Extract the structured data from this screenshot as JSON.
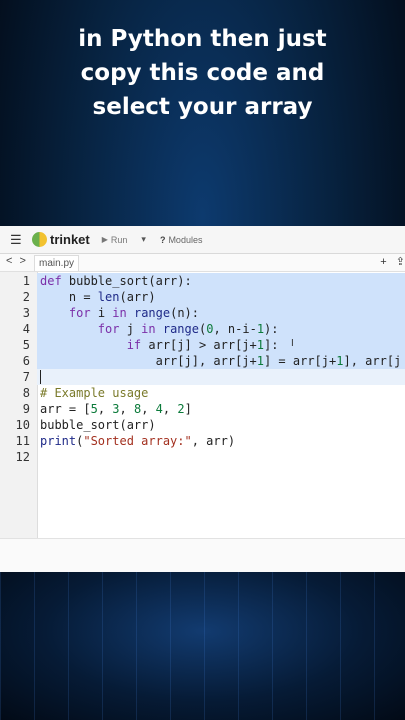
{
  "caption": {
    "line1": "in Python then just",
    "line2": "copy this code and",
    "line3": "select your array"
  },
  "toolbar": {
    "brand": "trinket",
    "run_label": "Run",
    "dropdown_glyph": "▾",
    "modules_label": "Modules",
    "modules_glyph": "?"
  },
  "tabs": {
    "nav": "< >",
    "file_name": "main.py",
    "add_glyph": "+",
    "upload_glyph": "⇪"
  },
  "editor": {
    "selected_lines": [
      1,
      2,
      3,
      4,
      5,
      6
    ],
    "cursor_line": 7,
    "lines": [
      {
        "n": "1",
        "text": "def bubble_sort(arr):"
      },
      {
        "n": "2",
        "text": "    n = len(arr)"
      },
      {
        "n": "3",
        "text": "    for i in range(n):"
      },
      {
        "n": "4",
        "text": "        for j in range(0, n-i-1):"
      },
      {
        "n": "5",
        "text": "            if arr[j] > arr[j+1]:"
      },
      {
        "n": "6",
        "text": "                arr[j], arr[j+1] = arr[j+1], arr[j"
      },
      {
        "n": "7",
        "text": ""
      },
      {
        "n": "8",
        "text": "# Example usage"
      },
      {
        "n": "9",
        "text": "arr = [5, 3, 8, 4, 2]"
      },
      {
        "n": "10",
        "text": "bubble_sort(arr)"
      },
      {
        "n": "11",
        "text": "print(\"Sorted array:\", arr)"
      },
      {
        "n": "12",
        "text": ""
      }
    ]
  },
  "icons": {
    "menu": "hamburger-menu-icon",
    "logo": "trinket-logo-icon",
    "run": "play-icon",
    "modules": "question-icon"
  },
  "colors": {
    "selection": "#cfe2fb",
    "background": "#07223f",
    "caption": "#ffffff"
  }
}
